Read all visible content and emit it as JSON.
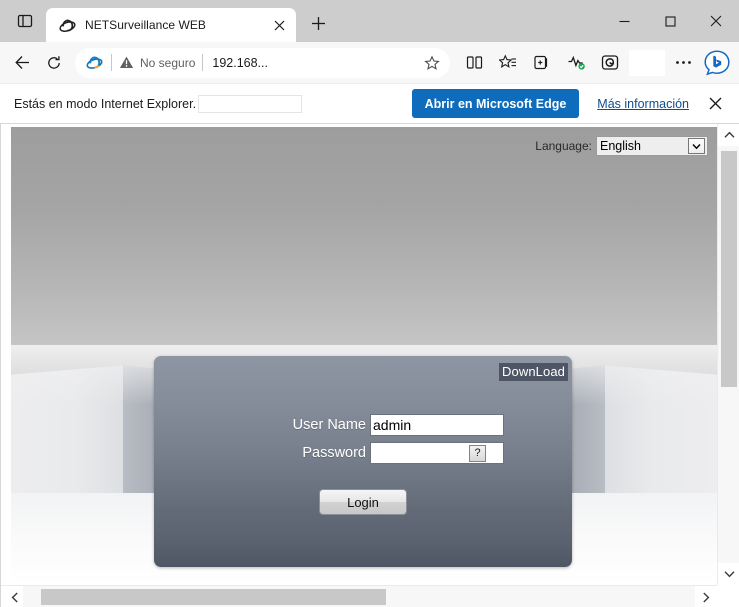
{
  "browser": {
    "tab": {
      "title": "NETSurveillance WEB",
      "favicon_icon": "internet-explorer-icon",
      "close_icon": "close-icon"
    },
    "tab_actions_icon": "tab-actions-icon",
    "new_tab_icon": "plus-icon",
    "window_controls": {
      "minimize_icon": "minimize-icon",
      "maximize_icon": "maximize-icon",
      "close_icon": "close-icon"
    },
    "toolbar": {
      "back_icon": "back-arrow-icon",
      "refresh_icon": "refresh-icon",
      "omnibox": {
        "ie_icon": "internet-explorer-icon",
        "security_icon": "warning-triangle-icon",
        "security_text": "No seguro",
        "url": "192.168...",
        "favorite_icon": "star-icon"
      },
      "split_screen_icon": "split-screen-icon",
      "favorites_icon": "favorites-star-icon",
      "collections_icon": "collections-icon",
      "browser_essentials_icon": "browser-essentials-icon",
      "copilot_edge_icon": "edge-copilot-icon",
      "profile_icon": "profile-button",
      "settings_more_icon": "ellipsis-icon",
      "bing_icon": "bing-chat-icon"
    },
    "ie_mode_bar": {
      "message": "Estás en modo Internet Explorer.",
      "open_in_edge_label": "Abrir en Microsoft Edge",
      "more_info_label": "Más información",
      "close_icon": "close-icon",
      "button_color": "#0f6cbd",
      "link_color": "#0f4d92"
    },
    "scrollbars": {
      "vertical": {
        "up_icon": "chevron-up-icon",
        "down_icon": "chevron-down-icon"
      },
      "horizontal": {
        "left_icon": "chevron-left-icon",
        "right_icon": "chevron-right-icon"
      }
    }
  },
  "page": {
    "language": {
      "label": "Language:",
      "selected": "English",
      "dropdown_icon": "chevron-down-icon",
      "options": [
        "English"
      ]
    },
    "login": {
      "download_label": "DownLoad",
      "username_label": "User Name",
      "username_value": "admin",
      "username_placeholder": "",
      "password_label": "Password",
      "password_value": "",
      "password_placeholder": "",
      "help_label": "?",
      "login_button_label": "Login"
    }
  }
}
